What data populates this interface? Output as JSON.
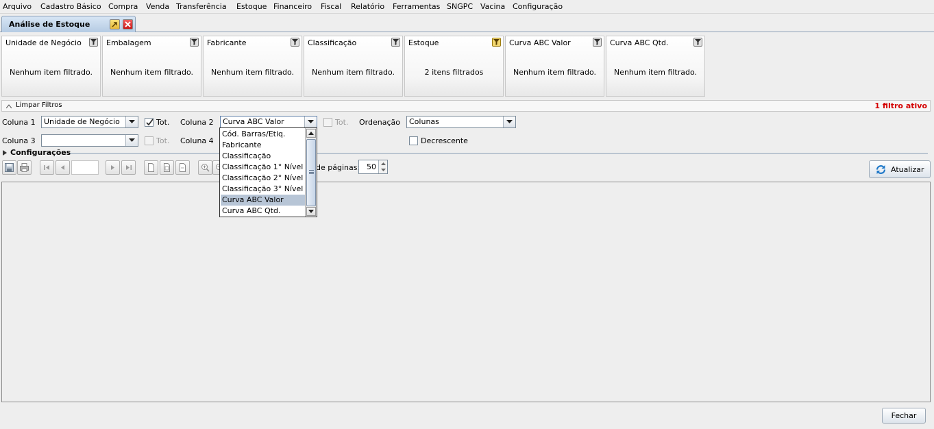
{
  "menu": {
    "items": [
      "Arquivo",
      "Cadastro Básico",
      "Compra",
      "Venda",
      "Transferência",
      "Estoque",
      "Financeiro",
      "Fiscal",
      "Relatório",
      "Ferramentas",
      "SNGPC",
      "Vacina",
      "Configuração"
    ]
  },
  "tab": {
    "label": "Análise de Estoque"
  },
  "filters": [
    {
      "title": "Unidade de Negócio",
      "status": "Nenhum item filtrado."
    },
    {
      "title": "Embalagem",
      "status": "Nenhum item filtrado."
    },
    {
      "title": "Fabricante",
      "status": "Nenhum item filtrado."
    },
    {
      "title": "Classificação",
      "status": "Nenhum item filtrado."
    },
    {
      "title": "Estoque",
      "status": "2 itens filtrados"
    },
    {
      "title": "Curva ABC Valor",
      "status": "Nenhum item filtrado."
    },
    {
      "title": "Curva ABC Qtd.",
      "status": "Nenhum item filtrado."
    }
  ],
  "clear_filters": {
    "label": "Limpar Filtros",
    "active_count": "1 filtro ativo",
    "active_color": "#d40000"
  },
  "columns": {
    "col1_label": "Coluna 1",
    "col1_value": "Unidade de Negócio",
    "col1_tot_label": "Tot.",
    "col1_tot_checked": true,
    "col2_label": "Coluna 2",
    "col2_value": "Curva ABC Valor",
    "col2_tot_label": "Tot.",
    "col2_tot_checked": false,
    "order_label": "Ordenação",
    "order_value": "Colunas",
    "col3_label": "Coluna 3",
    "col3_value": "",
    "col3_tot_label": "Tot.",
    "col4_label": "Coluna 4",
    "desc_label": "Decrescente",
    "desc_checked": false
  },
  "dropdown": {
    "options": [
      "Cód. Barras/Etiq.",
      "Fabricante",
      "Classificação",
      "Classificação 1° Nível",
      "Classificação 2° Nível",
      "Classificação 3° Nível",
      "Curva ABC Valor",
      "Curva ABC Qtd."
    ],
    "selected": "Curva ABC Valor"
  },
  "config": {
    "label": "Configurações"
  },
  "toolbar": {
    "page_value": "",
    "pages_label": "de páginas:",
    "pages_value": "50",
    "refresh_label": "Atualizar"
  },
  "footer": {
    "close_label": "Fechar"
  }
}
